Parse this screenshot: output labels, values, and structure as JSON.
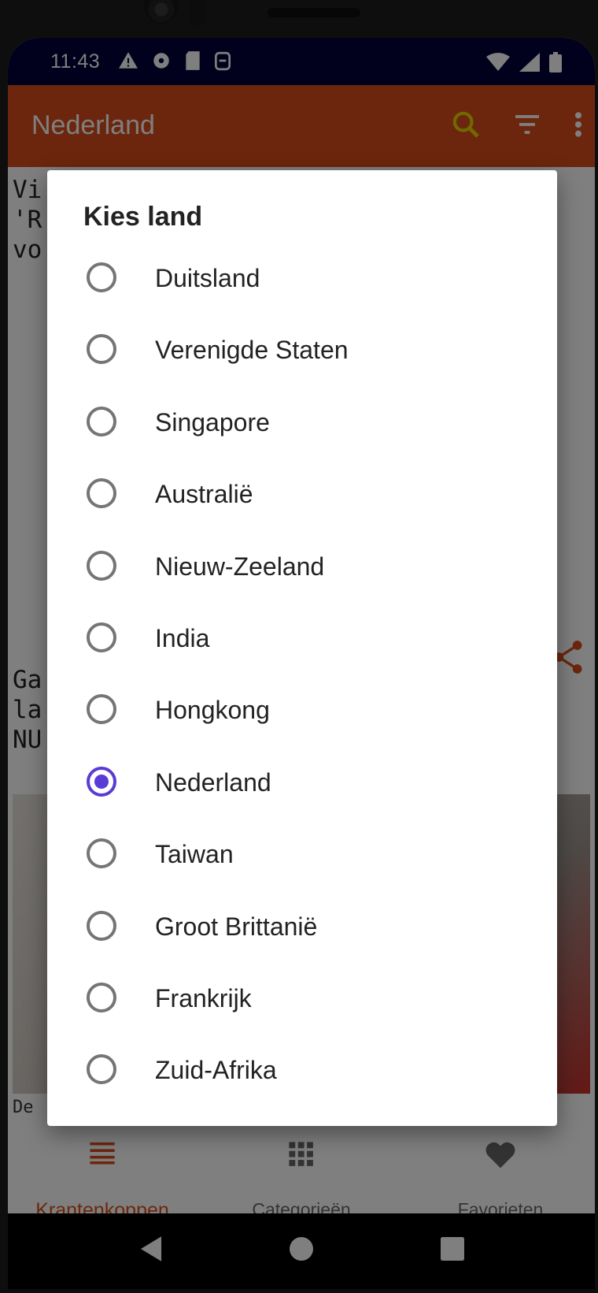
{
  "status_bar": {
    "time": "11:43"
  },
  "app_bar": {
    "title": "Nederland"
  },
  "background_articles": {
    "article1": "Vi\n'R                                           t\nvo",
    "article2": "Ga\nla                                            -\nNU",
    "article2_desc": "De\nzo'\npun"
  },
  "bottom_nav": {
    "items": [
      {
        "label": "Krantenkoppen",
        "active": true
      },
      {
        "label": "Categorieën",
        "active": false
      },
      {
        "label": "Favorieten",
        "active": false
      }
    ]
  },
  "dialog": {
    "title": "Kies land",
    "options": [
      {
        "label": "Duitsland",
        "selected": false
      },
      {
        "label": "Verenigde Staten",
        "selected": false
      },
      {
        "label": "Singapore",
        "selected": false
      },
      {
        "label": "Australië",
        "selected": false
      },
      {
        "label": "Nieuw-Zeeland",
        "selected": false
      },
      {
        "label": "India",
        "selected": false
      },
      {
        "label": "Hongkong",
        "selected": false
      },
      {
        "label": "Nederland",
        "selected": true
      },
      {
        "label": "Taiwan",
        "selected": false
      },
      {
        "label": "Groot Brittanië",
        "selected": false
      },
      {
        "label": "Frankrijk",
        "selected": false
      },
      {
        "label": "Zuid-Afrika",
        "selected": false
      }
    ]
  },
  "colors": {
    "app_bar": "#d94d1a",
    "status_bar": "#03033a",
    "radio_selected": "#5b3bd6",
    "radio_unselected": "#757575"
  }
}
